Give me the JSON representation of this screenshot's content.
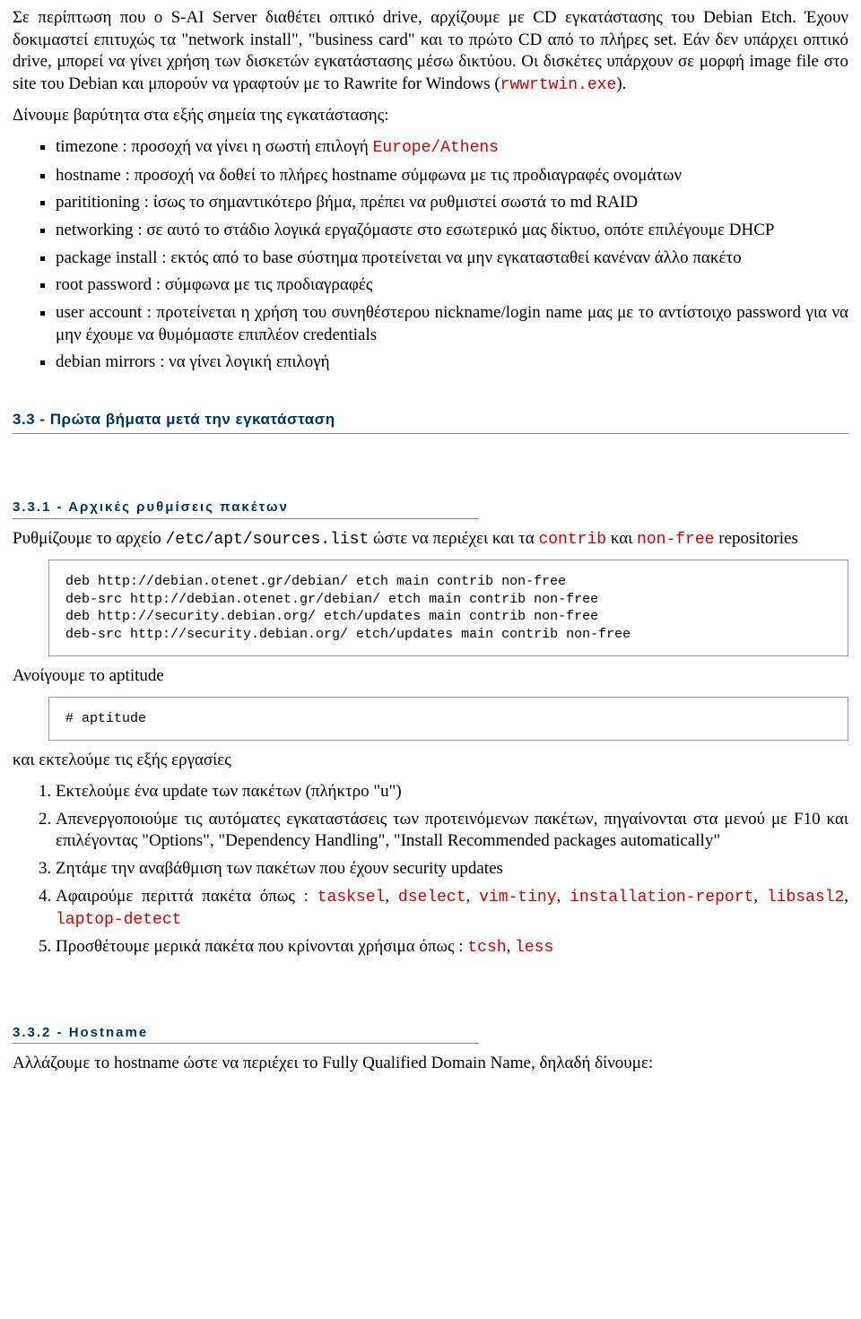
{
  "para1_a": "Σε περίπτωση που ο S-AI Server διαθέτει οπτικό drive, αρχίζουμε με CD εγκατάστασης του Debian Etch. Έχουν δοκιμαστεί επιτυχώς τα \"network install\", \"business card\" και το πρώτο CD από το πλήρες set. Εάν δεν υπάρχει οπτικό drive, μπορεί να γίνει χρήση των δισκετών εγκατάστασης μέσω δικτύου. Οι δισκέτες υπάρχουν σε μορφή image file στο site του Debian και μπορούν να γραφτούν με το Rawrite for Windows (",
  "para1_code": "rwwrtwin.exe",
  "para1_b": ").",
  "para2": "Δίνουμε βαρύτητα στα εξής σημεία της εγκατάστασης:",
  "bullets1": {
    "i0a": "timezone : προσοχή να γίνει η σωστή επιλογή ",
    "i0b": "Europe/Athens",
    "i1": "hostname : προσοχή να δοθεί το πλήρες hostname σύμφωνα με τις προδιαγραφές ονομάτων",
    "i2": "parititioning : ίσως το σημαντικότερο βήμα, πρέπει να ρυθμιστεί σωστά το md RAID",
    "i3": "networking : σε αυτό το στάδιο λογικά εργαζόμαστε στο εσωτερικό μας δίκτυο, οπότε επιλέγουμε DHCP",
    "i4": "package install : εκτός από το base σύστημα προτείνεται να μην εγκατασταθεί κανέναν άλλο πακέτο",
    "i5": "root password : σύμφωνα με τις προδιαγραφές",
    "i6": "user account : προτείνεται η χρήση του συνηθέστερου nickname/login name μας με το αντίστοιχο password για να μην έχουμε να θυμόμαστε επιπλέον credentials",
    "i7": "debian mirrors : να γίνει λογική επιλογή"
  },
  "sec33": "3.3 - Πρώτα βήματα μετά την εγκατάσταση",
  "sec331": "3.3.1 - Αρχικές ρυθμίσεις πακέτων",
  "para3_a": "Ρυθμίζουμε το αρχείο ",
  "para3_code1": "/etc/apt/sources.list",
  "para3_b": " ώστε να περιέχει και τα ",
  "para3_code2": "contrib",
  "para3_c": " και ",
  "para3_code3": "non-free",
  "para3_d": " repositories",
  "codebox1": "deb http://debian.otenet.gr/debian/ etch main contrib non-free\ndeb-src http://debian.otenet.gr/debian/ etch main contrib non-free\ndeb http://security.debian.org/ etch/updates main contrib non-free\ndeb-src http://security.debian.org/ etch/updates main contrib non-free",
  "para4": "Ανοίγουμε το aptitude",
  "codebox2": "# aptitude",
  "para5": "και εκτελούμε τις εξής εργασίες",
  "ol": {
    "i1": "Εκτελούμε ένα update των πακέτων (πλήκτρο \"u\")",
    "i2": "Απενεργοποιούμε τις αυτόματες εγκαταστάσεις των προτεινόμενων πακέτων, πηγαίνονται στα μενού με F10 και επιλέγοντας \"Options\", \"Dependency Handling\", \"Install Recommended packages automatically\"",
    "i3": "Ζητάμε την αναβάθμιση των πακέτων που έχουν security updates",
    "i4a": "Αφαιρούμε περιττά πακέτα όπως : ",
    "i4_pkg": [
      "tasksel",
      "dselect",
      "vim-tiny",
      "installation-report",
      "libsasl2",
      "laptop-detect"
    ],
    "i5a": "Προσθέτουμε μερικά πακέτα που κρίνονται χρήσιμα όπως : ",
    "i5_pkg": [
      "tcsh",
      "less"
    ]
  },
  "sec332": "3.3.2 - Hostname",
  "para6": "Αλλάζουμε το hostname ώστε να περιέχει το Fully Qualified Domain Name, δηλαδή δίνουμε:",
  "sep": ", "
}
